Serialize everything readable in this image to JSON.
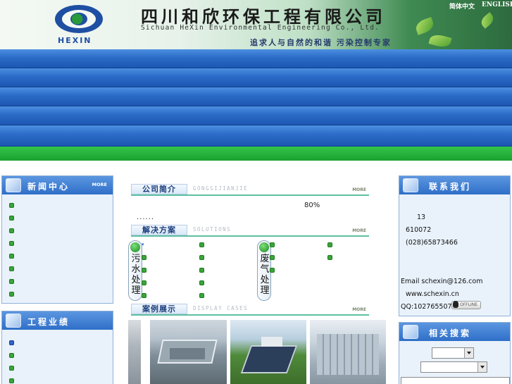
{
  "header": {
    "logo_text": "HEXIN",
    "company_cn": "四川和欣环保工程有限公司",
    "company_en": "Sichuan HeXin Environmental Engineering Co., Ltd.",
    "slogan": "追求人与自然的和谐   污染控制专家",
    "lang_cn": "简体中文",
    "lang_en": "ENGLISH"
  },
  "left": {
    "news": {
      "title": "新闻中心",
      "more": "MORE"
    },
    "projects": {
      "title": "工程业绩"
    }
  },
  "center": {
    "intro": {
      "title": "公司简介",
      "en": "GONGSIJIANJIE",
      "more": "MORE",
      "percent": "80%",
      "ellipsis": "......"
    },
    "solutions": {
      "title": "解决方案",
      "en": "SOLUTIONS",
      "more": "MORE",
      "water": "污水处理",
      "gas": "废气处理"
    },
    "cases": {
      "title": "案例展示",
      "en": "DISPLAY CASES",
      "more": "MORE"
    }
  },
  "right": {
    "contact": {
      "title": "联系我们",
      "line1": "13",
      "postcode": "610072",
      "phone": "(028)65873466",
      "email": "Email schexin@126.com",
      "web": "www.schexin.cn",
      "qq": "QQ:1027655073",
      "qq_status": "OFFLINE"
    },
    "search": {
      "title": "相关搜索"
    }
  },
  "colors": {
    "nav_blue": "#2b6bc8",
    "green_bar": "#1aa12f",
    "section_line": "#5ec0a2"
  }
}
